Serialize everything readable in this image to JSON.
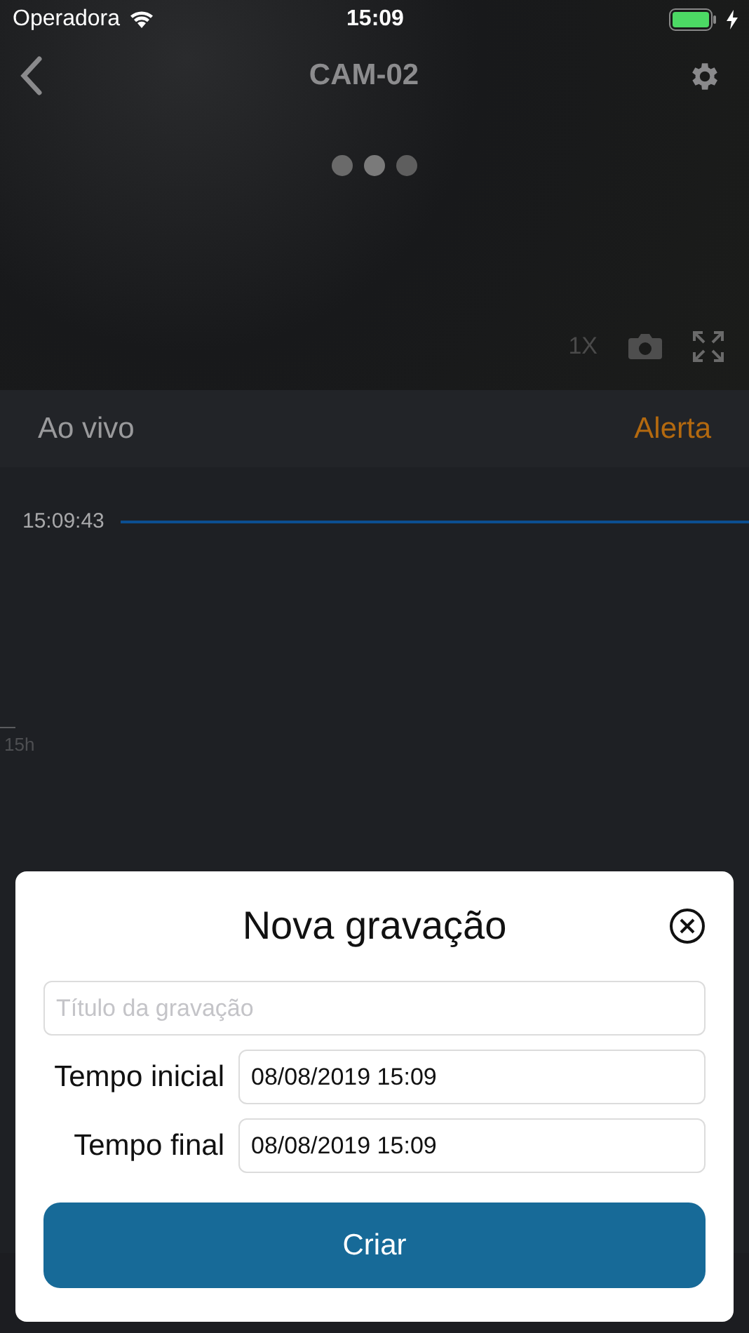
{
  "status_bar": {
    "carrier": "Operadora",
    "time": "15:09",
    "charging": true
  },
  "header": {
    "title": "CAM-02"
  },
  "video": {
    "zoom": "1X"
  },
  "mode_tabs": [
    {
      "label": "Ao vivo",
      "selected": false
    },
    {
      "label": "Alerta",
      "selected": true
    }
  ],
  "timeline": {
    "current_time": "15:09:43",
    "tick": "15h"
  },
  "dialog": {
    "title": "Nova gravação",
    "title_field": {
      "placeholder": "Título da gravação"
    },
    "rows": [
      {
        "label": "Tempo inicial",
        "value": "08/08/2019 15:09"
      },
      {
        "label": "Tempo final",
        "value": "08/08/2019 15:09"
      }
    ],
    "button": "Criar"
  }
}
